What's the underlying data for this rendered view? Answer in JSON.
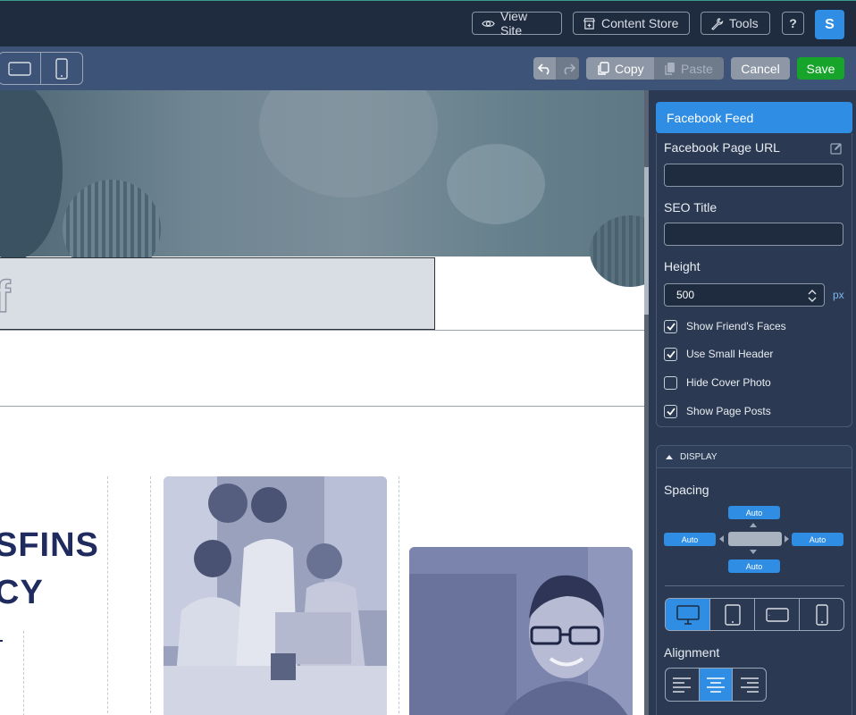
{
  "topbar": {
    "view_site": "View Site",
    "content_store": "Content Store",
    "tools": "Tools",
    "help": "?",
    "avatar_initial": "S"
  },
  "toolbar": {
    "copy": "Copy",
    "paste": "Paste",
    "cancel": "Cancel",
    "save": "Save"
  },
  "canvas": {
    "heading_line1": "SFINS",
    "heading_line2": "CY",
    "fb_glyph": "f"
  },
  "panel": {
    "title": "Facebook Feed",
    "fields": {
      "page_url_label": "Facebook Page URL",
      "page_url_value": "",
      "seo_title_label": "SEO Title",
      "seo_title_value": "",
      "height_label": "Height",
      "height_value": "500",
      "height_unit": "px"
    },
    "checkboxes": [
      {
        "label": "Show Friend's Faces",
        "checked": true
      },
      {
        "label": "Use Small Header",
        "checked": true
      },
      {
        "label": "Hide Cover Photo",
        "checked": false
      },
      {
        "label": "Show Page Posts",
        "checked": true
      }
    ],
    "display": {
      "section_label": "DISPLAY",
      "spacing_label": "Spacing",
      "spacing_top": "Auto",
      "spacing_left": "Auto",
      "spacing_right": "Auto",
      "spacing_bottom": "Auto",
      "alignment_label": "Alignment",
      "active_device": "desktop",
      "active_alignment": "center"
    }
  },
  "colors": {
    "accent": "#2f8de4",
    "save": "#16a52a",
    "panel_bg": "#2b3a52",
    "topbar_bg": "#1f2c3f",
    "heading": "#1f2b5e"
  }
}
